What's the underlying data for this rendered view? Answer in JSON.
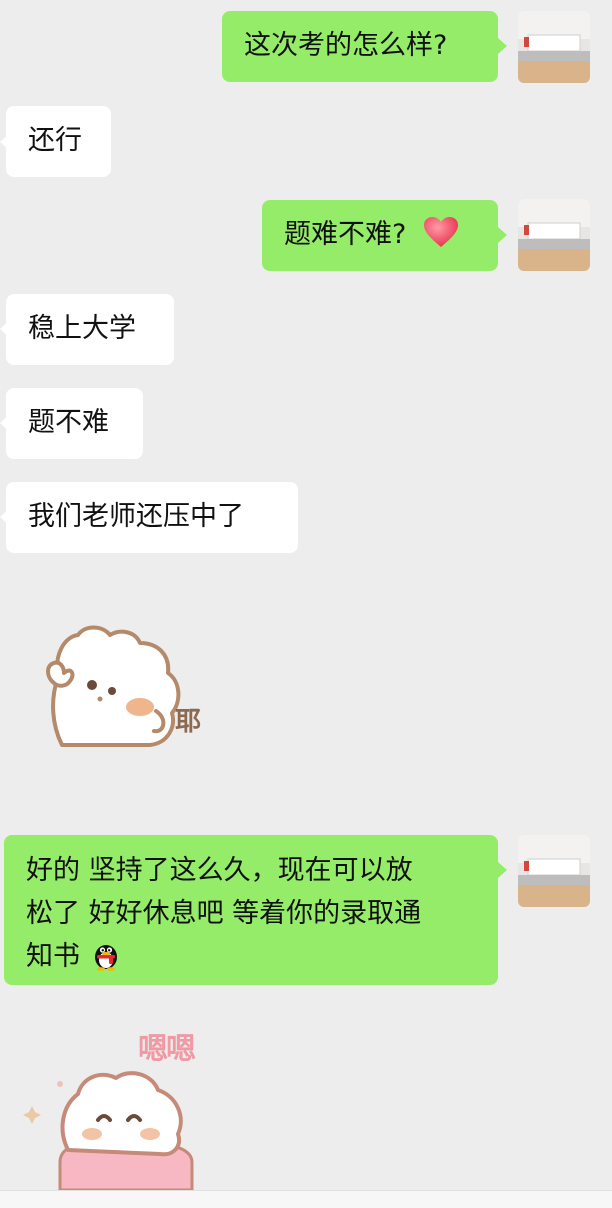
{
  "messages": [
    {
      "id": "m1",
      "side": "out",
      "text": "这次考的怎么样?"
    },
    {
      "id": "m2",
      "side": "in",
      "text": "还行"
    },
    {
      "id": "m3",
      "side": "out",
      "text": "题难不难?",
      "emoji": "heart-icon"
    },
    {
      "id": "m4",
      "side": "in",
      "text": "稳上大学"
    },
    {
      "id": "m5",
      "side": "in",
      "text": "题不难"
    },
    {
      "id": "m6",
      "side": "in",
      "text": "我们老师还压中了"
    },
    {
      "id": "m7",
      "side": "in",
      "sticker": "bear-yay-sticker",
      "sticker_text": "耶"
    },
    {
      "id": "m8",
      "side": "out",
      "lines": [
        "好的 坚持了这么久，现在可以放",
        "松了 好好休息吧 等着你的录取通",
        "知书"
      ],
      "emoji": "penguin-icon"
    },
    {
      "id": "m9",
      "side": "in",
      "sticker": "bear-enen-sticker",
      "sticker_text": "嗯嗯"
    }
  ],
  "colors": {
    "outgoing": "#95ec69",
    "incoming": "#ffffff",
    "background": "#ededed"
  }
}
